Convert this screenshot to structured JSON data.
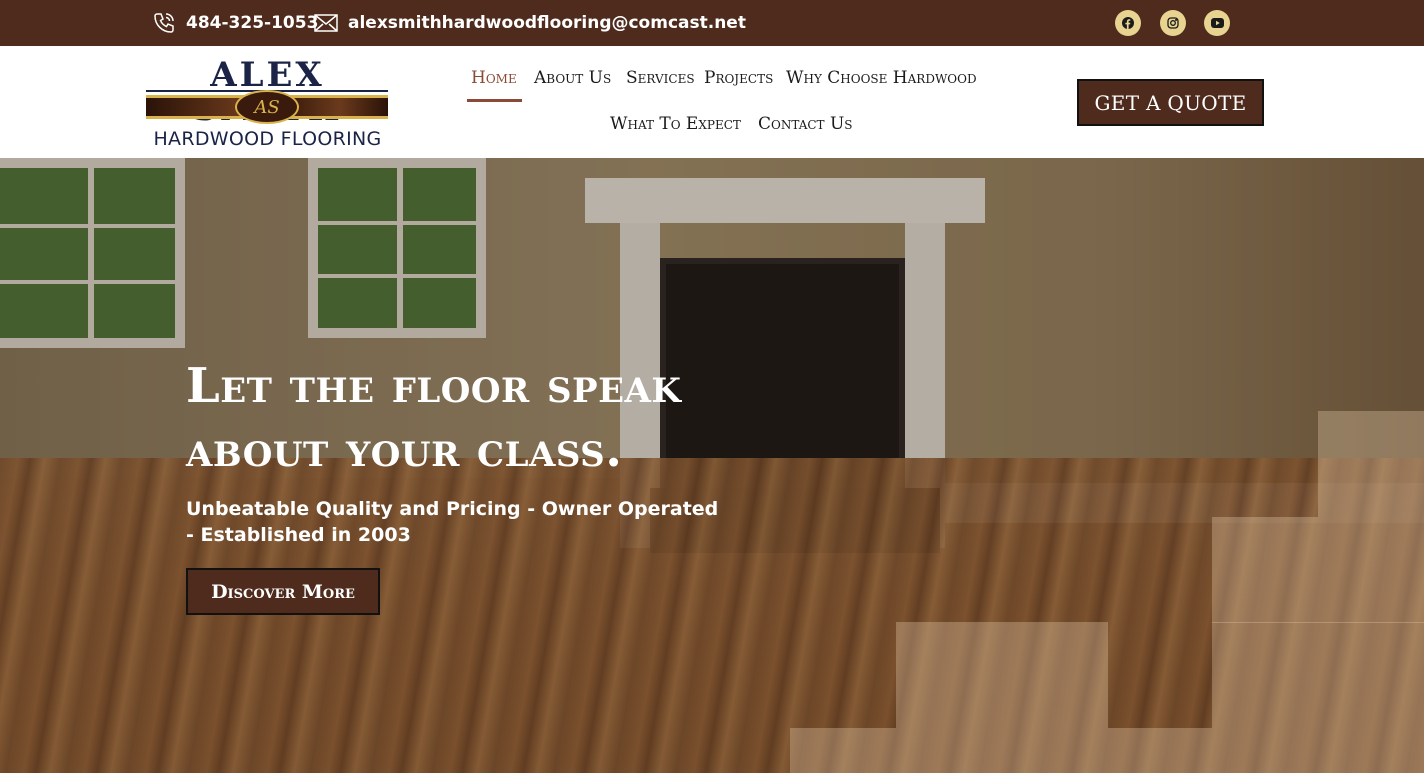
{
  "topbar": {
    "phone": "484-325-1053",
    "email": "alexsmithhardwoodflooring@comcast.net",
    "social": [
      {
        "icon": "facebook-icon"
      },
      {
        "icon": "instagram-icon"
      },
      {
        "icon": "youtube-icon"
      }
    ]
  },
  "header": {
    "logo": {
      "name": "ALEX SMITH",
      "monogram": "AS",
      "subtitle": "HARDWOOD FLOORING"
    },
    "nav": [
      {
        "label": "Home",
        "active": true
      },
      {
        "label": "About Us"
      },
      {
        "label": "Services"
      },
      {
        "label": "Projects"
      },
      {
        "label": "Why Choose Hardwood"
      },
      {
        "label": "What To Expect"
      },
      {
        "label": "Contact Us"
      }
    ],
    "quote_button": "GET A QUOTE"
  },
  "hero": {
    "heading": "Let the floor speak about your class.",
    "tagline": "Unbeatable Quality and Pricing - Owner Operated - Established in 2003",
    "cta": "Discover More"
  },
  "colors": {
    "brand_brown": "#4e2b1c",
    "accent_gold": "#e8d490",
    "nav_active": "#8b4a38",
    "logo_navy": "#1b2447"
  }
}
